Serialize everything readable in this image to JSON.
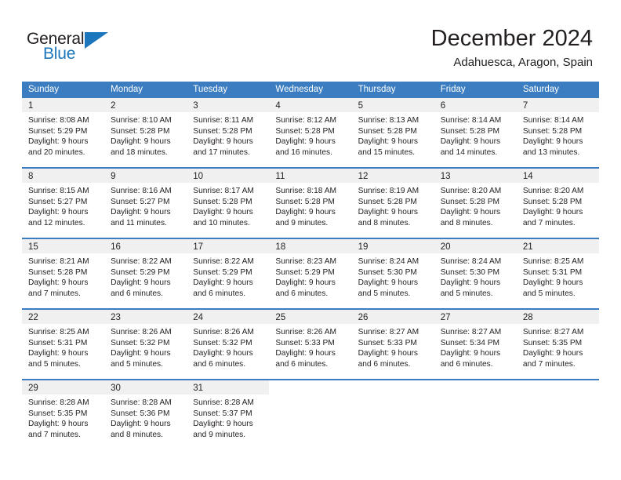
{
  "brand": {
    "name_top": "General",
    "name_bottom": "Blue",
    "accent_color": "#1b76bc"
  },
  "header": {
    "title": "December 2024",
    "subtitle": "Adahuesca, Aragon, Spain"
  },
  "calendar": {
    "header_color": "#3b7dc0",
    "weekdays": [
      "Sunday",
      "Monday",
      "Tuesday",
      "Wednesday",
      "Thursday",
      "Friday",
      "Saturday"
    ],
    "weeks": [
      [
        {
          "day": "1",
          "sunrise": "Sunrise: 8:08 AM",
          "sunset": "Sunset: 5:29 PM",
          "daylight1": "Daylight: 9 hours",
          "daylight2": "and 20 minutes."
        },
        {
          "day": "2",
          "sunrise": "Sunrise: 8:10 AM",
          "sunset": "Sunset: 5:28 PM",
          "daylight1": "Daylight: 9 hours",
          "daylight2": "and 18 minutes."
        },
        {
          "day": "3",
          "sunrise": "Sunrise: 8:11 AM",
          "sunset": "Sunset: 5:28 PM",
          "daylight1": "Daylight: 9 hours",
          "daylight2": "and 17 minutes."
        },
        {
          "day": "4",
          "sunrise": "Sunrise: 8:12 AM",
          "sunset": "Sunset: 5:28 PM",
          "daylight1": "Daylight: 9 hours",
          "daylight2": "and 16 minutes."
        },
        {
          "day": "5",
          "sunrise": "Sunrise: 8:13 AM",
          "sunset": "Sunset: 5:28 PM",
          "daylight1": "Daylight: 9 hours",
          "daylight2": "and 15 minutes."
        },
        {
          "day": "6",
          "sunrise": "Sunrise: 8:14 AM",
          "sunset": "Sunset: 5:28 PM",
          "daylight1": "Daylight: 9 hours",
          "daylight2": "and 14 minutes."
        },
        {
          "day": "7",
          "sunrise": "Sunrise: 8:14 AM",
          "sunset": "Sunset: 5:28 PM",
          "daylight1": "Daylight: 9 hours",
          "daylight2": "and 13 minutes."
        }
      ],
      [
        {
          "day": "8",
          "sunrise": "Sunrise: 8:15 AM",
          "sunset": "Sunset: 5:27 PM",
          "daylight1": "Daylight: 9 hours",
          "daylight2": "and 12 minutes."
        },
        {
          "day": "9",
          "sunrise": "Sunrise: 8:16 AM",
          "sunset": "Sunset: 5:27 PM",
          "daylight1": "Daylight: 9 hours",
          "daylight2": "and 11 minutes."
        },
        {
          "day": "10",
          "sunrise": "Sunrise: 8:17 AM",
          "sunset": "Sunset: 5:28 PM",
          "daylight1": "Daylight: 9 hours",
          "daylight2": "and 10 minutes."
        },
        {
          "day": "11",
          "sunrise": "Sunrise: 8:18 AM",
          "sunset": "Sunset: 5:28 PM",
          "daylight1": "Daylight: 9 hours",
          "daylight2": "and 9 minutes."
        },
        {
          "day": "12",
          "sunrise": "Sunrise: 8:19 AM",
          "sunset": "Sunset: 5:28 PM",
          "daylight1": "Daylight: 9 hours",
          "daylight2": "and 8 minutes."
        },
        {
          "day": "13",
          "sunrise": "Sunrise: 8:20 AM",
          "sunset": "Sunset: 5:28 PM",
          "daylight1": "Daylight: 9 hours",
          "daylight2": "and 8 minutes."
        },
        {
          "day": "14",
          "sunrise": "Sunrise: 8:20 AM",
          "sunset": "Sunset: 5:28 PM",
          "daylight1": "Daylight: 9 hours",
          "daylight2": "and 7 minutes."
        }
      ],
      [
        {
          "day": "15",
          "sunrise": "Sunrise: 8:21 AM",
          "sunset": "Sunset: 5:28 PM",
          "daylight1": "Daylight: 9 hours",
          "daylight2": "and 7 minutes."
        },
        {
          "day": "16",
          "sunrise": "Sunrise: 8:22 AM",
          "sunset": "Sunset: 5:29 PM",
          "daylight1": "Daylight: 9 hours",
          "daylight2": "and 6 minutes."
        },
        {
          "day": "17",
          "sunrise": "Sunrise: 8:22 AM",
          "sunset": "Sunset: 5:29 PM",
          "daylight1": "Daylight: 9 hours",
          "daylight2": "and 6 minutes."
        },
        {
          "day": "18",
          "sunrise": "Sunrise: 8:23 AM",
          "sunset": "Sunset: 5:29 PM",
          "daylight1": "Daylight: 9 hours",
          "daylight2": "and 6 minutes."
        },
        {
          "day": "19",
          "sunrise": "Sunrise: 8:24 AM",
          "sunset": "Sunset: 5:30 PM",
          "daylight1": "Daylight: 9 hours",
          "daylight2": "and 5 minutes."
        },
        {
          "day": "20",
          "sunrise": "Sunrise: 8:24 AM",
          "sunset": "Sunset: 5:30 PM",
          "daylight1": "Daylight: 9 hours",
          "daylight2": "and 5 minutes."
        },
        {
          "day": "21",
          "sunrise": "Sunrise: 8:25 AM",
          "sunset": "Sunset: 5:31 PM",
          "daylight1": "Daylight: 9 hours",
          "daylight2": "and 5 minutes."
        }
      ],
      [
        {
          "day": "22",
          "sunrise": "Sunrise: 8:25 AM",
          "sunset": "Sunset: 5:31 PM",
          "daylight1": "Daylight: 9 hours",
          "daylight2": "and 5 minutes."
        },
        {
          "day": "23",
          "sunrise": "Sunrise: 8:26 AM",
          "sunset": "Sunset: 5:32 PM",
          "daylight1": "Daylight: 9 hours",
          "daylight2": "and 5 minutes."
        },
        {
          "day": "24",
          "sunrise": "Sunrise: 8:26 AM",
          "sunset": "Sunset: 5:32 PM",
          "daylight1": "Daylight: 9 hours",
          "daylight2": "and 6 minutes."
        },
        {
          "day": "25",
          "sunrise": "Sunrise: 8:26 AM",
          "sunset": "Sunset: 5:33 PM",
          "daylight1": "Daylight: 9 hours",
          "daylight2": "and 6 minutes."
        },
        {
          "day": "26",
          "sunrise": "Sunrise: 8:27 AM",
          "sunset": "Sunset: 5:33 PM",
          "daylight1": "Daylight: 9 hours",
          "daylight2": "and 6 minutes."
        },
        {
          "day": "27",
          "sunrise": "Sunrise: 8:27 AM",
          "sunset": "Sunset: 5:34 PM",
          "daylight1": "Daylight: 9 hours",
          "daylight2": "and 6 minutes."
        },
        {
          "day": "28",
          "sunrise": "Sunrise: 8:27 AM",
          "sunset": "Sunset: 5:35 PM",
          "daylight1": "Daylight: 9 hours",
          "daylight2": "and 7 minutes."
        }
      ],
      [
        {
          "day": "29",
          "sunrise": "Sunrise: 8:28 AM",
          "sunset": "Sunset: 5:35 PM",
          "daylight1": "Daylight: 9 hours",
          "daylight2": "and 7 minutes."
        },
        {
          "day": "30",
          "sunrise": "Sunrise: 8:28 AM",
          "sunset": "Sunset: 5:36 PM",
          "daylight1": "Daylight: 9 hours",
          "daylight2": "and 8 minutes."
        },
        {
          "day": "31",
          "sunrise": "Sunrise: 8:28 AM",
          "sunset": "Sunset: 5:37 PM",
          "daylight1": "Daylight: 9 hours",
          "daylight2": "and 9 minutes."
        },
        {
          "day": "",
          "sunrise": "",
          "sunset": "",
          "daylight1": "",
          "daylight2": ""
        },
        {
          "day": "",
          "sunrise": "",
          "sunset": "",
          "daylight1": "",
          "daylight2": ""
        },
        {
          "day": "",
          "sunrise": "",
          "sunset": "",
          "daylight1": "",
          "daylight2": ""
        },
        {
          "day": "",
          "sunrise": "",
          "sunset": "",
          "daylight1": "",
          "daylight2": ""
        }
      ]
    ]
  }
}
